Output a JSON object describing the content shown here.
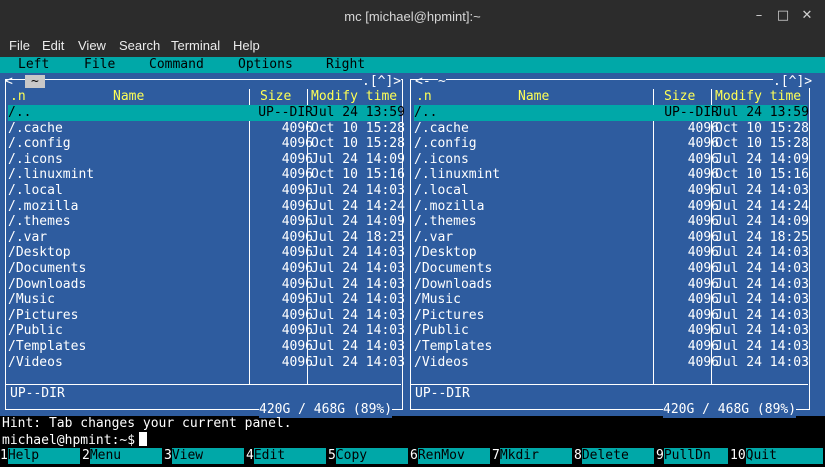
{
  "window": {
    "title": "mc [michael@hpmint]:~"
  },
  "menubar": [
    "File",
    "Edit",
    "View",
    "Search",
    "Terminal",
    "Help"
  ],
  "mcmenu": [
    "Left",
    "File",
    "Command",
    "Options",
    "Right"
  ],
  "left_panel": {
    "path": "~",
    "scroll_mark": ".[^]>",
    "headers": {
      "n": ".n",
      "name": "Name",
      "size": "Size",
      "mtime": "Modify time"
    },
    "rows": [
      {
        "name": "/..",
        "size": "UP--DIR",
        "mtime": "Jul 24 13:59"
      },
      {
        "name": "/.cache",
        "size": "4096",
        "mtime": "Oct 10 15:28"
      },
      {
        "name": "/.config",
        "size": "4096",
        "mtime": "Oct 10 15:28"
      },
      {
        "name": "/.icons",
        "size": "4096",
        "mtime": "Jul 24 14:09"
      },
      {
        "name": "/.linuxmint",
        "size": "4096",
        "mtime": "Oct 10 15:16"
      },
      {
        "name": "/.local",
        "size": "4096",
        "mtime": "Jul 24 14:03"
      },
      {
        "name": "/.mozilla",
        "size": "4096",
        "mtime": "Jul 24 14:24"
      },
      {
        "name": "/.themes",
        "size": "4096",
        "mtime": "Jul 24 14:09"
      },
      {
        "name": "/.var",
        "size": "4096",
        "mtime": "Jul 24 18:25"
      },
      {
        "name": "/Desktop",
        "size": "4096",
        "mtime": "Jul 24 14:03"
      },
      {
        "name": "/Documents",
        "size": "4096",
        "mtime": "Jul 24 14:03"
      },
      {
        "name": "/Downloads",
        "size": "4096",
        "mtime": "Jul 24 14:03"
      },
      {
        "name": "/Music",
        "size": "4096",
        "mtime": "Jul 24 14:03"
      },
      {
        "name": "/Pictures",
        "size": "4096",
        "mtime": "Jul 24 14:03"
      },
      {
        "name": "/Public",
        "size": "4096",
        "mtime": "Jul 24 14:03"
      },
      {
        "name": "/Templates",
        "size": "4096",
        "mtime": "Jul 24 14:03"
      },
      {
        "name": "/Videos",
        "size": "4096",
        "mtime": "Jul 24 14:03"
      }
    ],
    "status": "UP--DIR",
    "disk": "420G / 468G (89%)"
  },
  "right_panel": {
    "path": "~",
    "scroll_mark": ".[^]>",
    "headers": {
      "n": ".n",
      "name": "Name",
      "size": "Size",
      "mtime": "Modify time"
    },
    "rows": [
      {
        "name": "/..",
        "size": "UP--DIR",
        "mtime": "Jul 24 13:59"
      },
      {
        "name": "/.cache",
        "size": "4096",
        "mtime": "Oct 10 15:28"
      },
      {
        "name": "/.config",
        "size": "4096",
        "mtime": "Oct 10 15:28"
      },
      {
        "name": "/.icons",
        "size": "4096",
        "mtime": "Jul 24 14:09"
      },
      {
        "name": "/.linuxmint",
        "size": "4096",
        "mtime": "Oct 10 15:16"
      },
      {
        "name": "/.local",
        "size": "4096",
        "mtime": "Jul 24 14:03"
      },
      {
        "name": "/.mozilla",
        "size": "4096",
        "mtime": "Jul 24 14:24"
      },
      {
        "name": "/.themes",
        "size": "4096",
        "mtime": "Jul 24 14:09"
      },
      {
        "name": "/.var",
        "size": "4096",
        "mtime": "Jul 24 18:25"
      },
      {
        "name": "/Desktop",
        "size": "4096",
        "mtime": "Jul 24 14:03"
      },
      {
        "name": "/Documents",
        "size": "4096",
        "mtime": "Jul 24 14:03"
      },
      {
        "name": "/Downloads",
        "size": "4096",
        "mtime": "Jul 24 14:03"
      },
      {
        "name": "/Music",
        "size": "4096",
        "mtime": "Jul 24 14:03"
      },
      {
        "name": "/Pictures",
        "size": "4096",
        "mtime": "Jul 24 14:03"
      },
      {
        "name": "/Public",
        "size": "4096",
        "mtime": "Jul 24 14:03"
      },
      {
        "name": "/Templates",
        "size": "4096",
        "mtime": "Jul 24 14:03"
      },
      {
        "name": "/Videos",
        "size": "4096",
        "mtime": "Jul 24 14:03"
      }
    ],
    "status": "UP--DIR",
    "disk": "420G / 468G (89%)"
  },
  "hint": "Hint: Tab changes your current panel.",
  "prompt": "michael@hpmint:~$",
  "fkeys": [
    {
      "n": "1",
      "label": "Help"
    },
    {
      "n": "2",
      "label": "Menu"
    },
    {
      "n": "3",
      "label": "View"
    },
    {
      "n": "4",
      "label": "Edit"
    },
    {
      "n": "5",
      "label": "Copy"
    },
    {
      "n": "6",
      "label": "RenMov"
    },
    {
      "n": "7",
      "label": "Mkdir"
    },
    {
      "n": "8",
      "label": "Delete"
    },
    {
      "n": "9",
      "label": "PullDn"
    },
    {
      "n": "10",
      "label": "Quit"
    }
  ],
  "colors": {
    "panel_bg": "#2e5c9f",
    "selection": "#00a8a8",
    "header": "#ffff55",
    "titlebar": "#2c2c2c"
  }
}
